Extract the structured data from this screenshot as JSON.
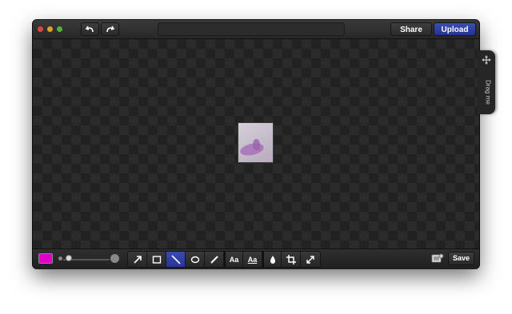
{
  "window": {
    "undo_icon": "undo-icon",
    "redo_icon": "redo-icon",
    "share_label": "Share",
    "upload_label": "Upload"
  },
  "canvas": {
    "drag_tab": {
      "icon": "move-icon",
      "label": "Drag me"
    }
  },
  "toolbar": {
    "color": "#e000c8",
    "brush_size": 0.1,
    "active_tool": "line",
    "tools": [
      {
        "name": "arrow",
        "icon": "arrow-icon"
      },
      {
        "name": "rectangle",
        "icon": "rectangle-icon"
      },
      {
        "name": "line",
        "icon": "line-icon"
      },
      {
        "name": "ellipse",
        "icon": "ellipse-icon"
      },
      {
        "name": "pencil",
        "icon": "pencil-icon"
      },
      {
        "name": "text",
        "icon": "text-icon",
        "label": "Aa"
      },
      {
        "name": "text-style",
        "icon": "text-style-icon",
        "label": "Aa"
      },
      {
        "name": "blur",
        "icon": "drop-icon"
      },
      {
        "name": "crop",
        "icon": "crop-icon"
      },
      {
        "name": "resize",
        "icon": "resize-icon"
      }
    ],
    "save_label": "Save"
  },
  "colors": {
    "accent": "#2d3ca4",
    "background": "#252525"
  }
}
